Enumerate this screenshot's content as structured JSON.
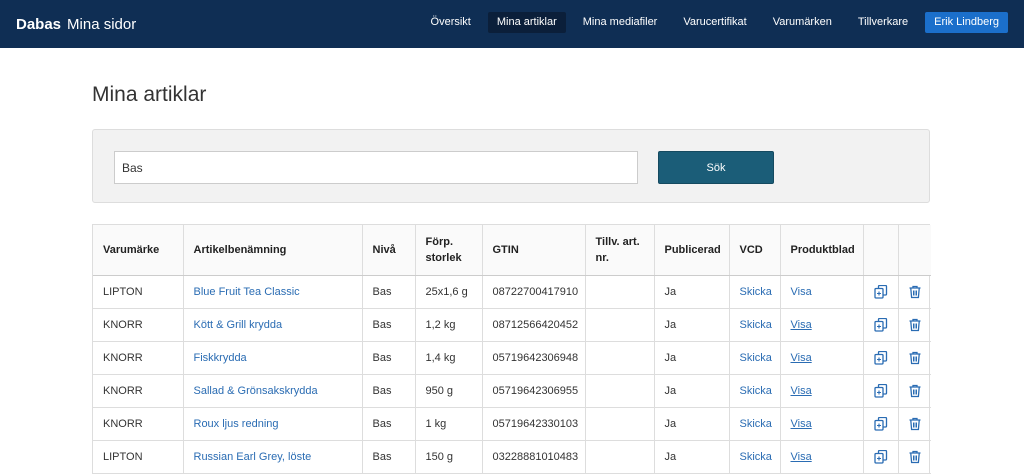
{
  "brand": {
    "primary": "Dabas",
    "secondary": "Mina sidor"
  },
  "nav": {
    "items": [
      {
        "label": "Översikt"
      },
      {
        "label": "Mina artiklar"
      },
      {
        "label": "Mina mediafiler"
      },
      {
        "label": "Varucertifikat"
      },
      {
        "label": "Varumärken"
      },
      {
        "label": "Tillverkare"
      }
    ],
    "user": "Erik Lindberg"
  },
  "page_title": "Mina artiklar",
  "search": {
    "value": "Bas",
    "button_label": "Sök"
  },
  "table": {
    "headers": {
      "brand": "Varumärke",
      "name": "Artikelbenämning",
      "level": "Nivå",
      "pack": "Förp. storlek",
      "gtin": "GTIN",
      "supplier_no": "Tillv. art. nr.",
      "published": "Publicerad",
      "vcd": "VCD",
      "sheet": "Produktblad"
    },
    "rows": [
      {
        "brand": "LIPTON",
        "name": "Blue Fruit Tea Classic",
        "level": "Bas",
        "pack": "25x1,6 g",
        "gtin": "08722700417910",
        "supplier_no": "",
        "published": "Ja",
        "vcd": "Skicka",
        "sheet": "Visa"
      },
      {
        "brand": "KNORR",
        "name": "Kött & Grill krydda",
        "level": "Bas",
        "pack": "1,2 kg",
        "gtin": "08712566420452",
        "supplier_no": "",
        "published": "Ja",
        "vcd": "Skicka",
        "sheet": "Visa"
      },
      {
        "brand": "KNORR",
        "name": "Fiskkrydda",
        "level": "Bas",
        "pack": "1,4 kg",
        "gtin": "05719642306948",
        "supplier_no": "",
        "published": "Ja",
        "vcd": "Skicka",
        "sheet": "Visa"
      },
      {
        "brand": "KNORR",
        "name": "Sallad & Grönsakskrydda",
        "level": "Bas",
        "pack": "950 g",
        "gtin": "05719642306955",
        "supplier_no": "",
        "published": "Ja",
        "vcd": "Skicka",
        "sheet": "Visa"
      },
      {
        "brand": "KNORR",
        "name": "Roux ljus redning",
        "level": "Bas",
        "pack": "1 kg",
        "gtin": "05719642330103",
        "supplier_no": "",
        "published": "Ja",
        "vcd": "Skicka",
        "sheet": "Visa"
      },
      {
        "brand": "LIPTON",
        "name": "Russian Earl Grey, löste",
        "level": "Bas",
        "pack": "150 g",
        "gtin": "03228881010483",
        "supplier_no": "",
        "published": "Ja",
        "vcd": "Skicka",
        "sheet": "Visa"
      }
    ],
    "row_icons": [
      "copy-icon",
      "trash-icon"
    ]
  },
  "colors": {
    "topbar": "#0f2e54",
    "active_nav": "#0b1f3a",
    "user_button": "#1b6fcb",
    "search_button": "#1b5d78",
    "link": "#2a6cb3"
  }
}
